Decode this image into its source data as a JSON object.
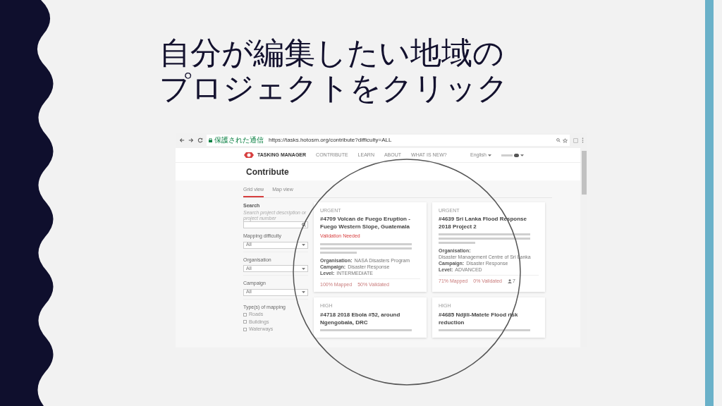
{
  "title": [
    "自分が編集したい地域の",
    "プロジェクトをクリック"
  ],
  "browser": {
    "security_label": "保護された通信",
    "url": "https://tasks.hotosm.org/contribute?difficulty=ALL"
  },
  "nav": {
    "brand": "TASKING MANAGER",
    "links": [
      "CONTRIBUTE",
      "LEARN",
      "ABOUT",
      "WHAT IS NEW?"
    ],
    "language": "English"
  },
  "page_title": "Contribute",
  "view_tabs": [
    {
      "label": "Grid view",
      "selected": true
    },
    {
      "label": "Map view",
      "selected": false
    }
  ],
  "filters": {
    "search_label": "Search",
    "search_hint": "Search project description or project number",
    "dropdowns": [
      {
        "label": "Mapping difficulty",
        "value": "All"
      },
      {
        "label": "Organisation",
        "value": "All"
      },
      {
        "label": "Campaign",
        "value": "All"
      }
    ],
    "types_label": "Type(s) of mapping",
    "types": [
      {
        "label": "Roads",
        "checked": false
      },
      {
        "label": "Buildings",
        "checked": false
      },
      {
        "label": "Waterways",
        "checked": false
      }
    ]
  },
  "projects": [
    {
      "priority": "URGENT",
      "title": "#4709 Volcan de Fuego Eruption - Fuego Western Slope, Guatemala",
      "status": "Validation Needed",
      "details": [
        {
          "label": "Organisation:",
          "value": "NASA Disasters Program"
        },
        {
          "label": "Campaign:",
          "value": "Disaster Response"
        },
        {
          "label": "Level:",
          "value": "INTERMEDIATE"
        }
      ],
      "stats": [
        "100% Mapped",
        "50% Validated"
      ]
    },
    {
      "priority": "URGENT",
      "title": "#4639 Sri Lanka Flood Response 2018 Project 2",
      "details": [
        {
          "label": "Organisation:",
          "value": "Disaster Management Centre of Sri Lanka"
        },
        {
          "label": "Campaign:",
          "value": "Disaster Response"
        },
        {
          "label": "Level:",
          "value": "ADVANCED"
        }
      ],
      "stats": [
        "71% Mapped",
        "0% Validated"
      ],
      "contributors": "7"
    },
    {
      "priority": "HIGH",
      "title": "#4718 2018 Ebola #52, around Ngengobala, DRC"
    },
    {
      "priority": "HIGH",
      "title": "#4685 Ndjili-Matete Flood risk reduction"
    }
  ]
}
